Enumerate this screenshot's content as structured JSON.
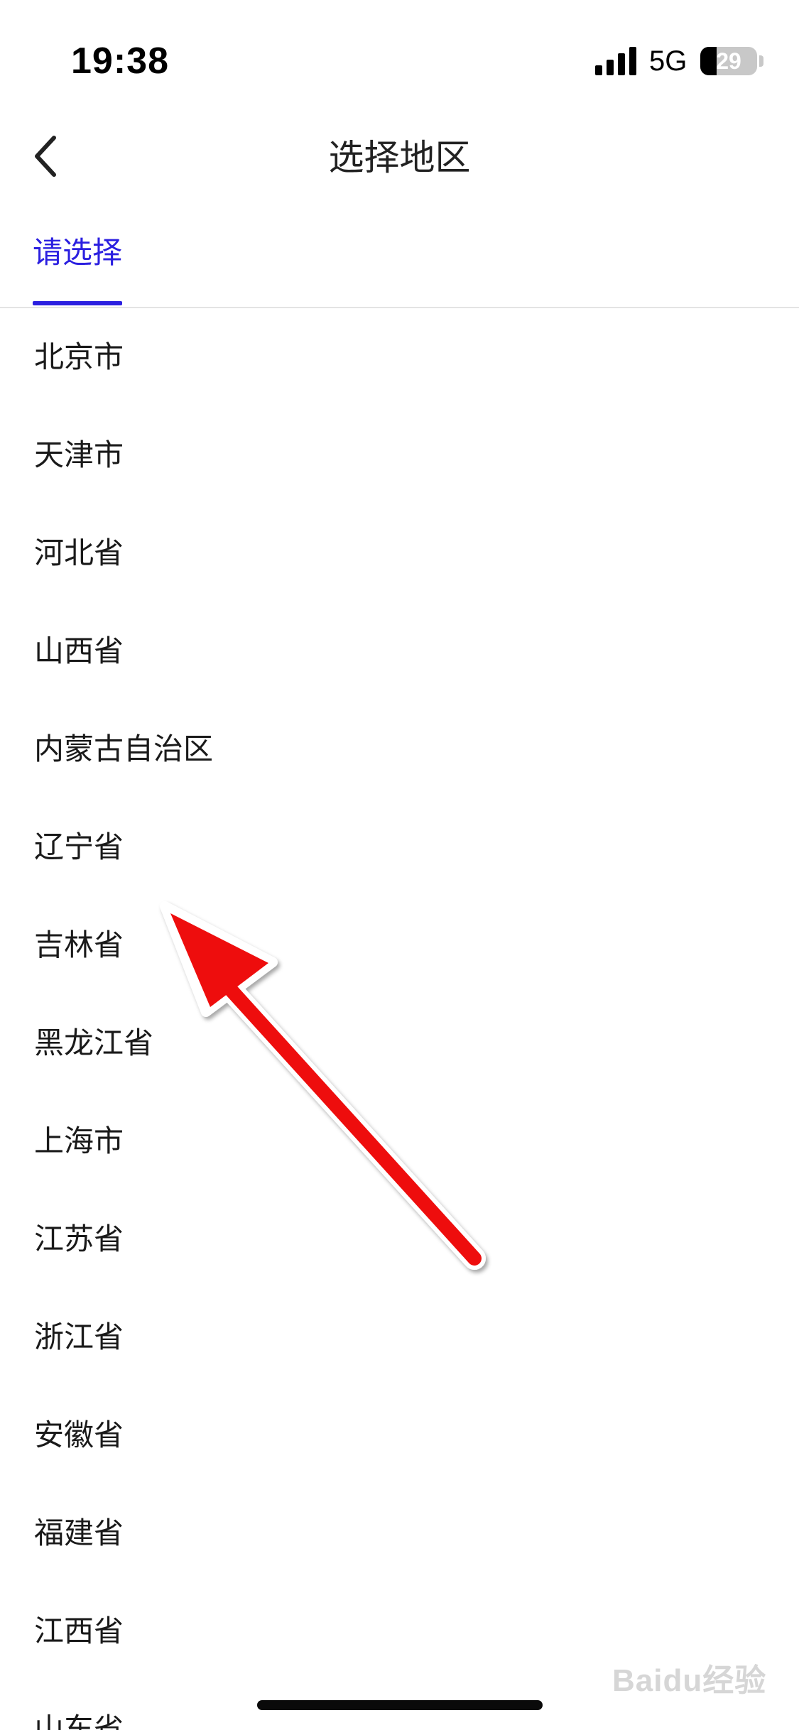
{
  "status_bar": {
    "time": "19:38",
    "network": "5G",
    "battery_level": "29",
    "battery_fraction": 0.29
  },
  "nav": {
    "title": "选择地区",
    "back_icon": "chevron-left-icon"
  },
  "tabs": {
    "selected_label": "请选择",
    "accent_color": "#2b1fe0"
  },
  "regions": [
    "北京市",
    "天津市",
    "河北省",
    "山西省",
    "内蒙古自治区",
    "辽宁省",
    "吉林省",
    "黑龙江省",
    "上海市",
    "江苏省",
    "浙江省",
    "安徽省",
    "福建省",
    "江西省",
    "山东省"
  ],
  "annotation": {
    "arrow_color": "#ee1111",
    "arrow_icon": "red-arrow-annotation"
  },
  "watermark": "Baidu经验"
}
